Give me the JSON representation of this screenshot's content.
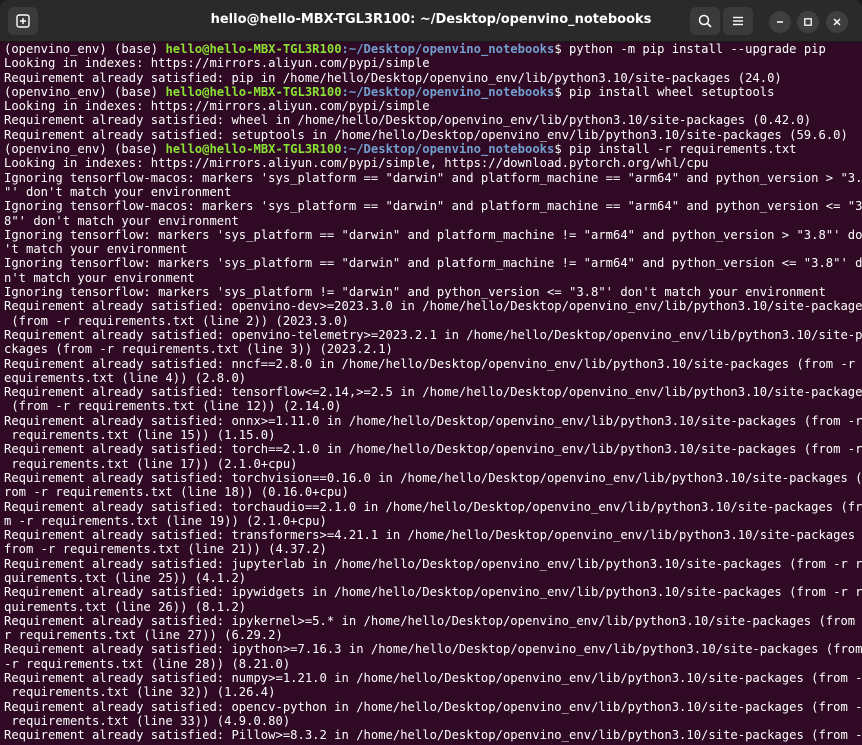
{
  "window": {
    "title": "hello@hello-MBX-TGL3R100: ~/Desktop/openvino_notebooks"
  },
  "prompt": {
    "env": "(openvino_env) (base) ",
    "user_host": "hello@hello-MBX-TGL3R100",
    "path": ":~/Desktop/openvino_notebooks",
    "symbol": "$ "
  },
  "lines": [
    {
      "type": "cmd",
      "text": "python -m pip install --upgrade pip"
    },
    {
      "type": "out",
      "text": "Looking in indexes: https://mirrors.aliyun.com/pypi/simple"
    },
    {
      "type": "out",
      "text": "Requirement already satisfied: pip in /home/hello/Desktop/openvino_env/lib/python3.10/site-packages (24.0)"
    },
    {
      "type": "cmd",
      "text": "pip install wheel setuptools"
    },
    {
      "type": "out",
      "text": "Looking in indexes: https://mirrors.aliyun.com/pypi/simple"
    },
    {
      "type": "out",
      "text": "Requirement already satisfied: wheel in /home/hello/Desktop/openvino_env/lib/python3.10/site-packages (0.42.0)"
    },
    {
      "type": "out",
      "text": "Requirement already satisfied: setuptools in /home/hello/Desktop/openvino_env/lib/python3.10/site-packages (59.6.0)"
    },
    {
      "type": "cmd",
      "text": "pip install -r requirements.txt"
    },
    {
      "type": "out",
      "text": "Looking in indexes: https://mirrors.aliyun.com/pypi/simple, https://download.pytorch.org/whl/cpu"
    },
    {
      "type": "out",
      "text": "Ignoring tensorflow-macos: markers 'sys_platform == \"darwin\" and platform_machine == \"arm64\" and python_version > \"3.8"
    },
    {
      "type": "out",
      "text": "\"' don't match your environment"
    },
    {
      "type": "out",
      "text": "Ignoring tensorflow-macos: markers 'sys_platform == \"darwin\" and platform_machine == \"arm64\" and python_version <= \"3."
    },
    {
      "type": "out",
      "text": "8\"' don't match your environment"
    },
    {
      "type": "out",
      "text": "Ignoring tensorflow: markers 'sys_platform == \"darwin\" and platform_machine != \"arm64\" and python_version > \"3.8\"' don"
    },
    {
      "type": "out",
      "text": "'t match your environment"
    },
    {
      "type": "out",
      "text": "Ignoring tensorflow: markers 'sys_platform == \"darwin\" and platform_machine != \"arm64\" and python_version <= \"3.8\"' do"
    },
    {
      "type": "out",
      "text": "n't match your environment"
    },
    {
      "type": "out",
      "text": "Ignoring tensorflow: markers 'sys_platform != \"darwin\" and python_version <= \"3.8\"' don't match your environment"
    },
    {
      "type": "out",
      "text": "Requirement already satisfied: openvino-dev>=2023.3.0 in /home/hello/Desktop/openvino_env/lib/python3.10/site-packages"
    },
    {
      "type": "out",
      "text": " (from -r requirements.txt (line 2)) (2023.3.0)"
    },
    {
      "type": "out",
      "text": "Requirement already satisfied: openvino-telemetry>=2023.2.1 in /home/hello/Desktop/openvino_env/lib/python3.10/site-pa"
    },
    {
      "type": "out",
      "text": "ckages (from -r requirements.txt (line 3)) (2023.2.1)"
    },
    {
      "type": "out",
      "text": "Requirement already satisfied: nncf==2.8.0 in /home/hello/Desktop/openvino_env/lib/python3.10/site-packages (from -r r"
    },
    {
      "type": "out",
      "text": "equirements.txt (line 4)) (2.8.0)"
    },
    {
      "type": "out",
      "text": "Requirement already satisfied: tensorflow<=2.14,>=2.5 in /home/hello/Desktop/openvino_env/lib/python3.10/site-packages"
    },
    {
      "type": "out",
      "text": " (from -r requirements.txt (line 12)) (2.14.0)"
    },
    {
      "type": "out",
      "text": "Requirement already satisfied: onnx>=1.11.0 in /home/hello/Desktop/openvino_env/lib/python3.10/site-packages (from -r"
    },
    {
      "type": "out",
      "text": " requirements.txt (line 15)) (1.15.0)"
    },
    {
      "type": "out",
      "text": "Requirement already satisfied: torch==2.1.0 in /home/hello/Desktop/openvino_env/lib/python3.10/site-packages (from -r"
    },
    {
      "type": "out",
      "text": " requirements.txt (line 17)) (2.1.0+cpu)"
    },
    {
      "type": "out",
      "text": "Requirement already satisfied: torchvision==0.16.0 in /home/hello/Desktop/openvino_env/lib/python3.10/site-packages (f"
    },
    {
      "type": "out",
      "text": "rom -r requirements.txt (line 18)) (0.16.0+cpu)"
    },
    {
      "type": "out",
      "text": "Requirement already satisfied: torchaudio==2.1.0 in /home/hello/Desktop/openvino_env/lib/python3.10/site-packages (fro"
    },
    {
      "type": "out",
      "text": "m -r requirements.txt (line 19)) (2.1.0+cpu)"
    },
    {
      "type": "out",
      "text": "Requirement already satisfied: transformers>=4.21.1 in /home/hello/Desktop/openvino_env/lib/python3.10/site-packages ("
    },
    {
      "type": "out",
      "text": "from -r requirements.txt (line 21)) (4.37.2)"
    },
    {
      "type": "out",
      "text": "Requirement already satisfied: jupyterlab in /home/hello/Desktop/openvino_env/lib/python3.10/site-packages (from -r re"
    },
    {
      "type": "out",
      "text": "quirements.txt (line 25)) (4.1.2)"
    },
    {
      "type": "out",
      "text": "Requirement already satisfied: ipywidgets in /home/hello/Desktop/openvino_env/lib/python3.10/site-packages (from -r re"
    },
    {
      "type": "out",
      "text": "quirements.txt (line 26)) (8.1.2)"
    },
    {
      "type": "out",
      "text": "Requirement already satisfied: ipykernel>=5.* in /home/hello/Desktop/openvino_env/lib/python3.10/site-packages (from -"
    },
    {
      "type": "out",
      "text": "r requirements.txt (line 27)) (6.29.2)"
    },
    {
      "type": "out",
      "text": "Requirement already satisfied: ipython>=7.16.3 in /home/hello/Desktop/openvino_env/lib/python3.10/site-packages (from"
    },
    {
      "type": "out",
      "text": "-r requirements.txt (line 28)) (8.21.0)"
    },
    {
      "type": "out",
      "text": "Requirement already satisfied: numpy>=1.21.0 in /home/hello/Desktop/openvino_env/lib/python3.10/site-packages (from -r"
    },
    {
      "type": "out",
      "text": " requirements.txt (line 32)) (1.26.4)"
    },
    {
      "type": "out",
      "text": "Requirement already satisfied: opencv-python in /home/hello/Desktop/openvino_env/lib/python3.10/site-packages (from -r"
    },
    {
      "type": "out",
      "text": " requirements.txt (line 33)) (4.9.0.80)"
    },
    {
      "type": "out",
      "text": "Requirement already satisfied: Pillow>=8.3.2 in /home/hello/Desktop/openvino_env/lib/python3.10/site-packages (from -r"
    }
  ],
  "icons": {
    "new_tab": "new-tab-icon",
    "search": "search-icon",
    "menu": "hamburger-menu-icon",
    "minimize": "minimize-icon",
    "maximize": "maximize-icon",
    "close": "close-icon"
  },
  "colors": {
    "terminal_bg": "#300a24",
    "user_host": "#8ae234",
    "path": "#729fcf",
    "text": "#ffffff"
  }
}
